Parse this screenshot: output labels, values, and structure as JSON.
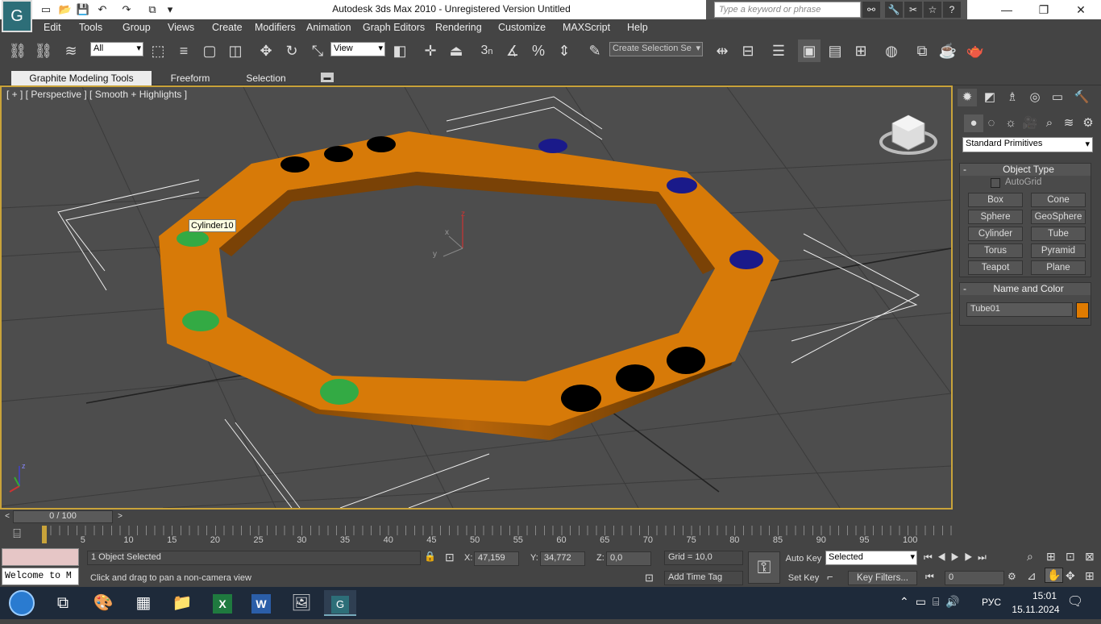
{
  "title": "Autodesk 3ds Max  2010  - Unregistered Version     Untitled",
  "search_placeholder": "Type a keyword or phrase",
  "menu": [
    "Edit",
    "Tools",
    "Group",
    "Views",
    "Create",
    "Modifiers",
    "Animation",
    "Graph Editors",
    "Rendering",
    "Customize",
    "MAXScript",
    "Help"
  ],
  "toolbar": {
    "filter": "All",
    "coord": "View",
    "selset": "Create Selection Se",
    "snap_angle": "3",
    "snap_label": "n"
  },
  "ribbon": {
    "tabs": [
      "Graphite Modeling Tools",
      "Freeform",
      "Selection"
    ]
  },
  "viewport": {
    "label": "[ + ] [ Perspective ] [ Smooth + Highlights ]",
    "tooltip": "Cylinder10",
    "axis": {
      "x": "x",
      "y": "y",
      "z": "z"
    }
  },
  "panel": {
    "dropdown": "Standard Primitives",
    "object_type": "Object Type",
    "autogrid": "AutoGrid",
    "buttons": [
      "Box",
      "Cone",
      "Sphere",
      "GeoSphere",
      "Cylinder",
      "Tube",
      "Torus",
      "Pyramid",
      "Teapot",
      "Plane"
    ],
    "name_color": "Name and Color",
    "object_name": "Tube01",
    "object_color": "#e07b00"
  },
  "timeline": {
    "frame": "0 / 100",
    "ticks": [
      "5",
      "10",
      "15",
      "20",
      "25",
      "30",
      "35",
      "40",
      "45",
      "50",
      "55",
      "60",
      "65",
      "70",
      "75",
      "80",
      "85",
      "90",
      "95",
      "100"
    ]
  },
  "status": {
    "welcome": "Welcome to M",
    "selected": "1 Object Selected",
    "prompt": "Click and drag to pan a non-camera view",
    "x_label": "X:",
    "x": "47,159",
    "y_label": "Y:",
    "y": "34,772",
    "z_label": "Z:",
    "z": "0,0",
    "grid": "Grid = 10,0",
    "add_time_tag": "Add Time Tag",
    "auto_key": "Auto Key",
    "set_key": "Set Key",
    "key_mode": "Selected",
    "key_filters": "Key Filters...",
    "frame_field": "0"
  },
  "taskbar": {
    "lang": "РУС",
    "time": "15:01",
    "date": "15.11.2024"
  }
}
